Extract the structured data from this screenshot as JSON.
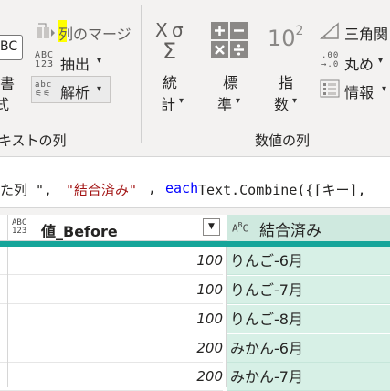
{
  "ribbon": {
    "text_group": {
      "abc_icon_text": "BC",
      "left_cut_label_1": "書",
      "left_cut_label_2": "式",
      "merge_columns": "列のマージ",
      "extract": "抽出",
      "parse": "解析",
      "group_label": "キストの列"
    },
    "number_group": {
      "statistics_1": "統",
      "statistics_2": "計",
      "standard_1": "標",
      "standard_2": "準",
      "scientific_1": "指",
      "scientific_2": "数",
      "trig": "三角関",
      "rounding": "丸め",
      "information": "情報",
      "group_label": "数値の列",
      "scientific_icon_base": "10",
      "scientific_icon_exp": "2",
      "rounding_icon_top": ".00",
      "rounding_icon_bottom": "→.0"
    }
  },
  "formula_bar": {
    "part1": "た列 \", ",
    "part2": "\"結合済み\"",
    "part3": ", ",
    "part4": "each",
    "part5": " Text.Combine({[キー],"
  },
  "grid": {
    "columns": [
      {
        "type_icon_top": "ABC",
        "type_icon_bottom": "123",
        "name": "値_Before"
      },
      {
        "type_icon_top": "A",
        "type_icon_sup": "B",
        "type_icon_bottom": "C",
        "name": "結合済み"
      }
    ],
    "rows": [
      {
        "value": "100",
        "combined": "りんご-6月"
      },
      {
        "value": "100",
        "combined": "りんご-7月"
      },
      {
        "value": "100",
        "combined": "りんご-8月"
      },
      {
        "value": "200",
        "combined": "みかん-6月"
      },
      {
        "value": "200",
        "combined": "みかん-7月"
      }
    ]
  },
  "colors": {
    "accent": "#16a59a",
    "selected_column": "#d7f0e6",
    "string_literal": "#a31515",
    "keyword": "#0000ff"
  },
  "icons": [
    "abc-text-icon",
    "merge-columns-icon",
    "extract-icon",
    "parse-icon",
    "statistics-sigma-icon",
    "standard-operators-icon",
    "scientific-icon",
    "trigonometry-icon",
    "rounding-icon",
    "information-icon",
    "filter-dropdown-icon"
  ]
}
